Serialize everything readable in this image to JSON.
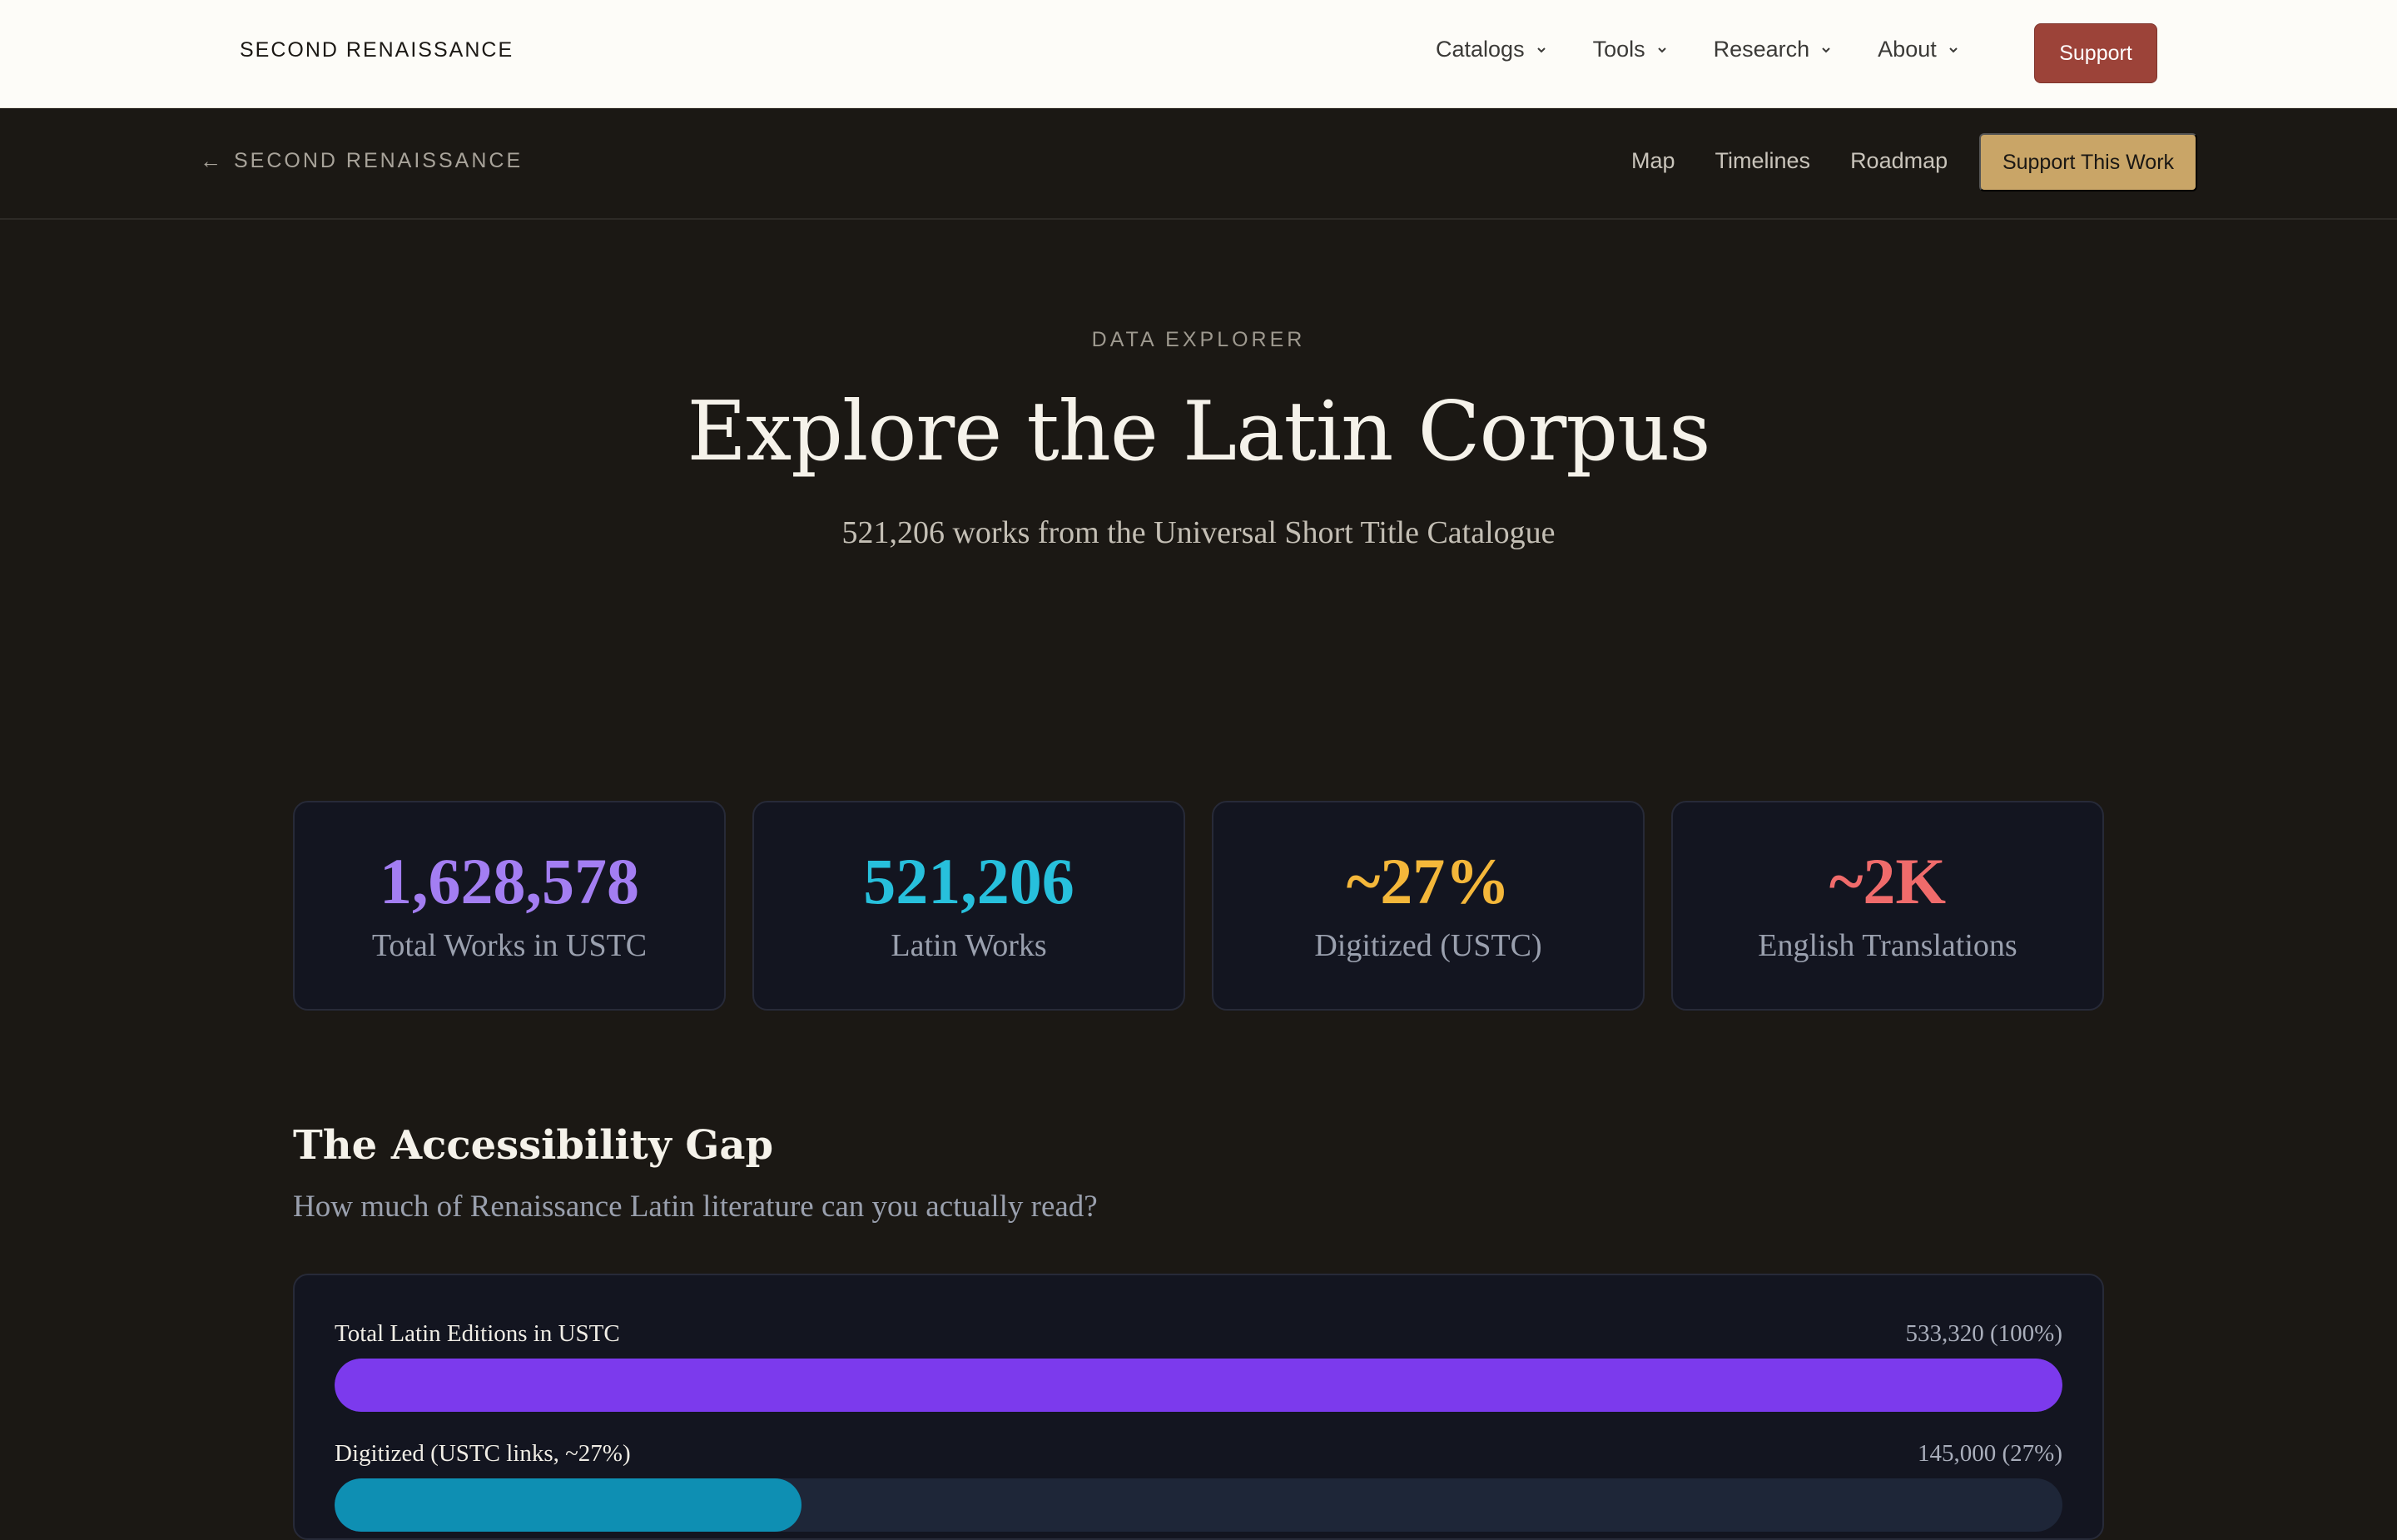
{
  "topnav": {
    "brand": "SECOND RENAISSANCE",
    "menu": [
      {
        "label": "Catalogs"
      },
      {
        "label": "Tools"
      },
      {
        "label": "Research"
      },
      {
        "label": "About"
      }
    ],
    "support_label": "Support",
    "support_color": "#9c4339"
  },
  "subnav": {
    "back_label": "SECOND RENAISSANCE",
    "links": [
      "Map",
      "Timelines",
      "Roadmap"
    ],
    "cta_label": "Support This Work",
    "cta_color": "#c9a567"
  },
  "hero": {
    "eyebrow": "DATA EXPLORER",
    "title": "Explore the Latin Corpus",
    "subtitle": "521,206 works from the Universal Short Title Catalogue"
  },
  "stats": [
    {
      "value": "1,628,578",
      "label": "Total Works in USTC",
      "color": "#a37ef2"
    },
    {
      "value": "521,206",
      "label": "Latin Works",
      "color": "#27c0dc"
    },
    {
      "value": "~27%",
      "label": "Digitized (USTC)",
      "color": "#f4b73a"
    },
    {
      "value": "~2K",
      "label": "English Translations",
      "color": "#f06b6b"
    }
  ],
  "gap": {
    "title": "The Accessibility Gap",
    "subtitle": "How much of Renaissance Latin literature can you actually read?",
    "bars": [
      {
        "label": "Total Latin Editions in USTC",
        "value": "533,320 (100%)",
        "fraction": 1.0,
        "color": "#7c3aed"
      },
      {
        "label": "Digitized (USTC links, ~27%)",
        "value": "145,000 (27%)",
        "fraction": 0.27,
        "color": "#0e8fb3"
      }
    ]
  }
}
